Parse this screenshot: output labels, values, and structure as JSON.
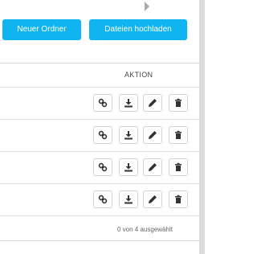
{
  "toolbar": {
    "new_folder_label": "Neuer Ordner",
    "upload_label": "Dateien hochladen"
  },
  "table": {
    "action_header": "AKTION",
    "rows": [
      {
        "actions": [
          "link-icon",
          "download-icon",
          "pencil-icon",
          "trash-icon"
        ]
      },
      {
        "actions": [
          "link-icon",
          "download-icon",
          "pencil-icon",
          "trash-icon"
        ]
      },
      {
        "actions": [
          "link-icon",
          "download-icon",
          "pencil-icon",
          "trash-icon"
        ]
      },
      {
        "actions": [
          "link-icon",
          "download-icon",
          "pencil-icon",
          "trash-icon"
        ]
      }
    ],
    "selection_status": "0 von 4 ausgewählt"
  },
  "colors": {
    "accent": "#10b4f0",
    "border": "#d4d4d4"
  }
}
